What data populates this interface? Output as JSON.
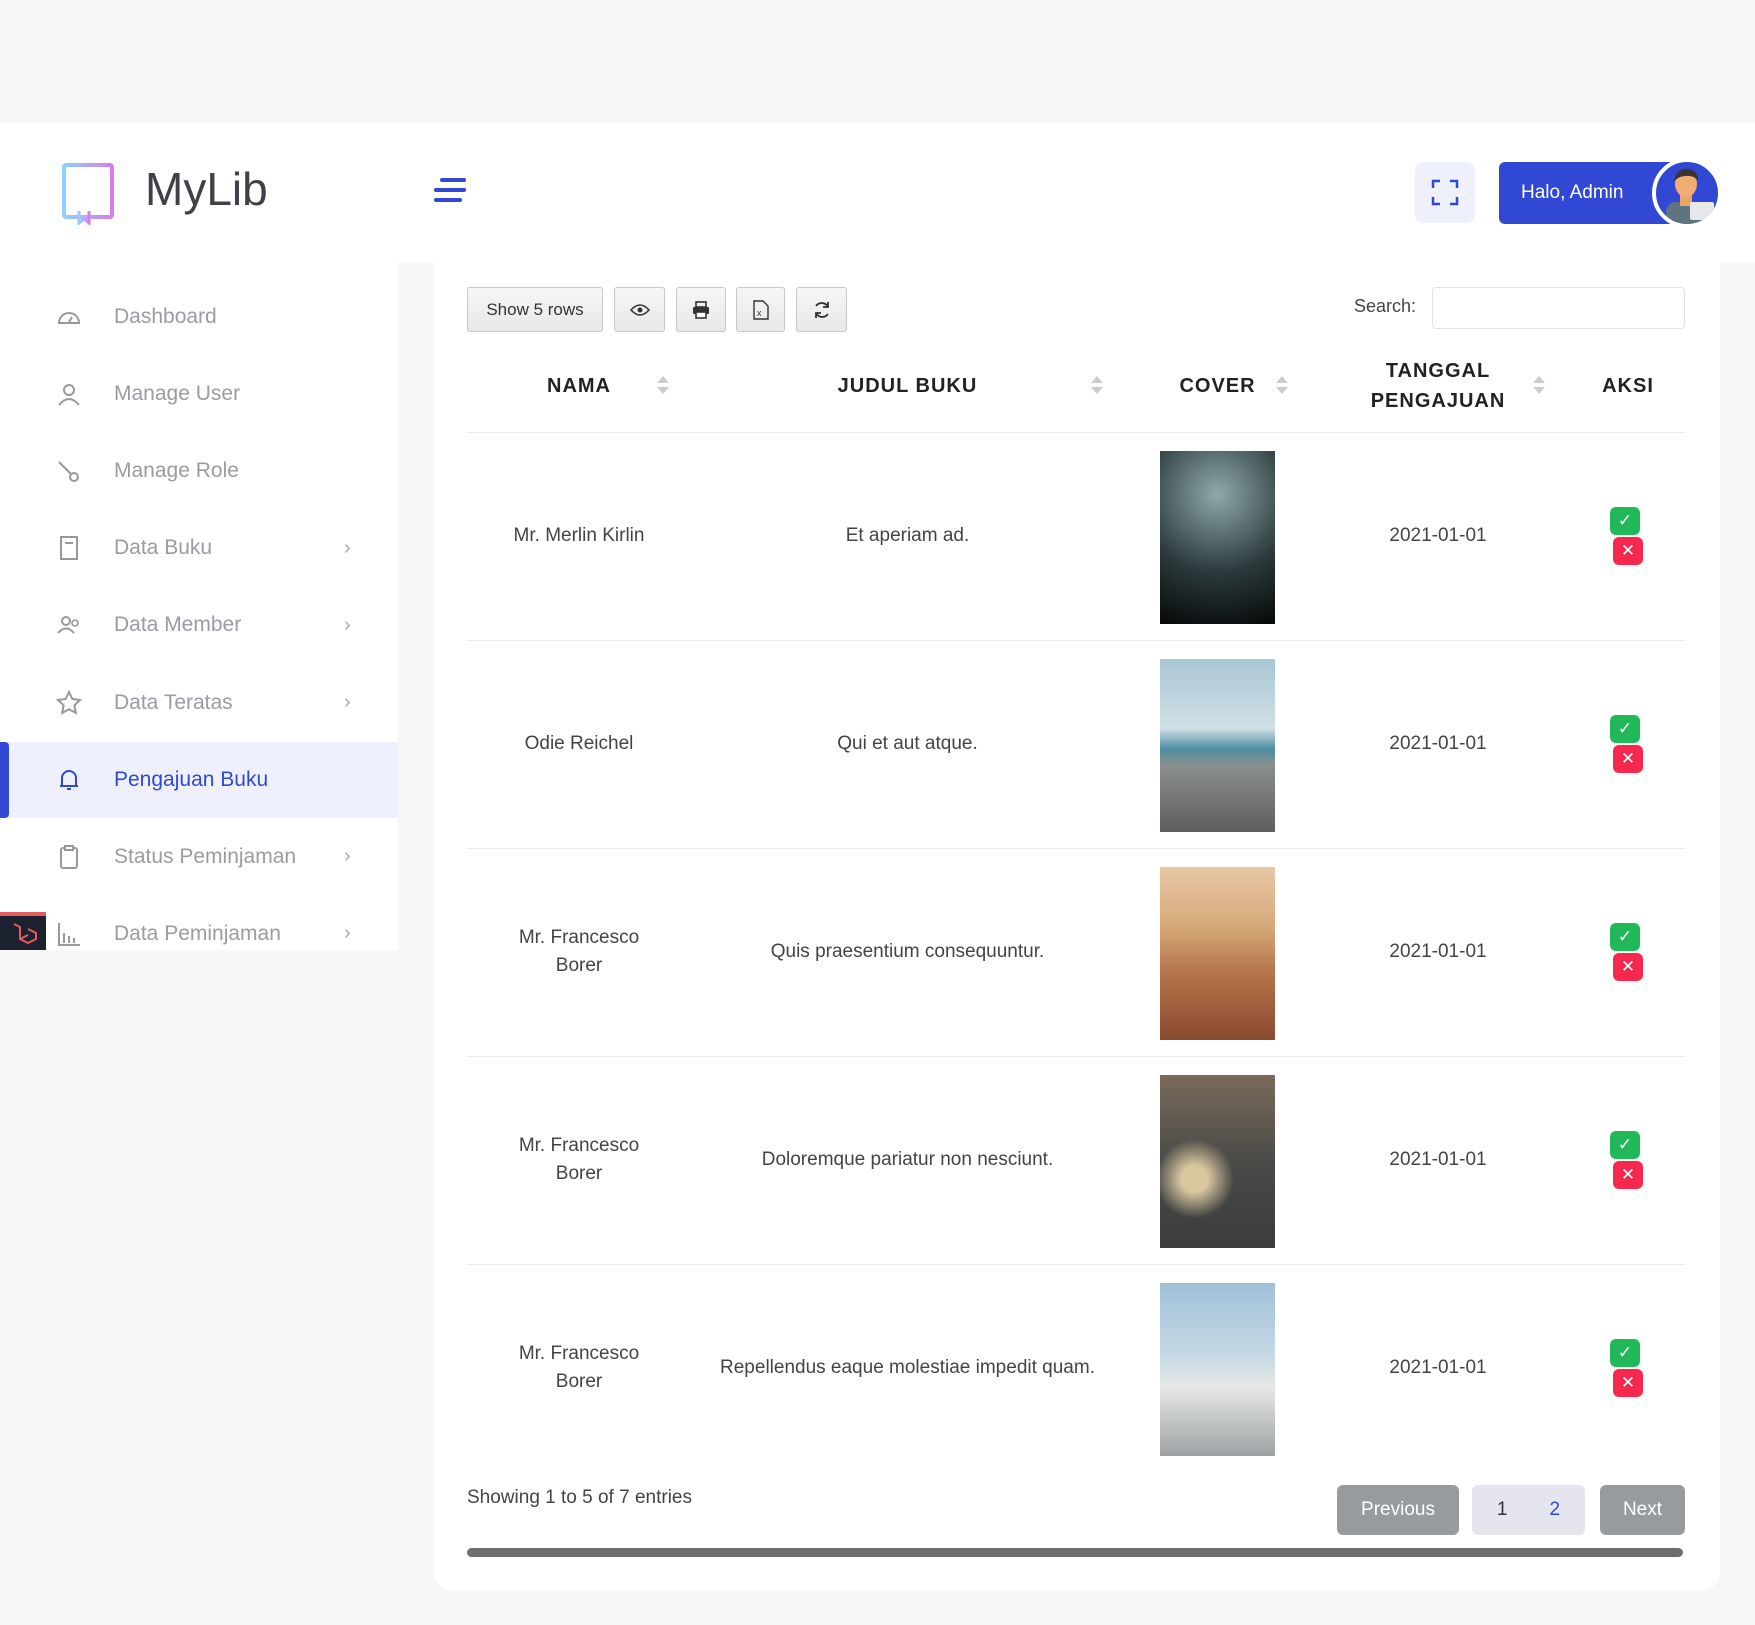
{
  "brand": {
    "name": "MyLib"
  },
  "sidebar": {
    "items": [
      {
        "label": "Dashboard",
        "icon": "gauge-icon",
        "chevron": false
      },
      {
        "label": "Manage User",
        "icon": "user-icon",
        "chevron": false
      },
      {
        "label": "Manage Role",
        "icon": "key-icon",
        "chevron": false
      },
      {
        "label": "Data Buku",
        "icon": "book-icon",
        "chevron": true
      },
      {
        "label": "Data Member",
        "icon": "users-icon",
        "chevron": true
      },
      {
        "label": "Data Teratas",
        "icon": "star-icon",
        "chevron": true
      },
      {
        "label": "Pengajuan Buku",
        "icon": "bell-icon",
        "chevron": false,
        "active": true
      },
      {
        "label": "Status Peminjaman",
        "icon": "clipboard-icon",
        "chevron": true
      },
      {
        "label": "Data Peminjaman",
        "icon": "bar-chart-icon",
        "chevron": true
      }
    ]
  },
  "header": {
    "user_label": "Halo, Admin"
  },
  "toolbar": {
    "show_rows": "Show 5 rows",
    "search_label": "Search:",
    "search_value": "",
    "search_placeholder": ""
  },
  "table": {
    "columns": [
      "NAMA",
      "JUDUL BUKU",
      "COVER",
      "TANGGAL PENGAJUAN",
      "AKSI"
    ],
    "rows": [
      {
        "nama": "Mr. Merlin Kirlin",
        "judul": "Et aperiam ad.",
        "tanggal": "2021-01-01",
        "cover": "forks"
      },
      {
        "nama": "Odie Reichel",
        "judul": "Qui et aut atque.",
        "tanggal": "2021-01-01",
        "cover": "beach"
      },
      {
        "nama": "Mr. Francesco Borer",
        "judul": "Quis praesentium consequuntur.",
        "tanggal": "2021-01-01",
        "cover": "desert"
      },
      {
        "nama": "Mr. Francesco Borer",
        "judul": "Doloremque pariatur non nesciunt.",
        "tanggal": "2021-01-01",
        "cover": "car"
      },
      {
        "nama": "Mr. Francesco Borer",
        "judul": "Repellendus eaque molestiae impedit quam.",
        "tanggal": "2021-01-01",
        "cover": "santorini"
      }
    ]
  },
  "footer": {
    "info": "Showing 1 to 5 of 7 entries",
    "previous": "Previous",
    "pages": [
      "1",
      "2"
    ],
    "next": "Next"
  },
  "colors": {
    "accent": "#3148d4",
    "approve": "#22b85a",
    "reject": "#f5284f"
  }
}
